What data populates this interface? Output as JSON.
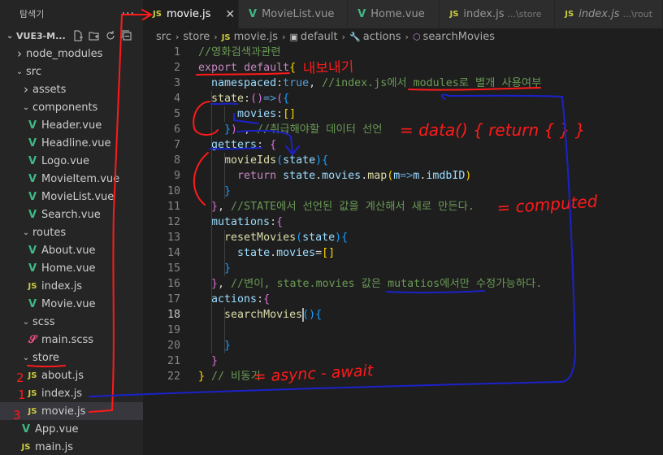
{
  "explorer": {
    "title": "탐색기",
    "more": "···",
    "project": "VUE3-M...",
    "tree": [
      {
        "label": "node_modules",
        "type": "folder",
        "open": false,
        "depth": 1
      },
      {
        "label": "src",
        "type": "folder",
        "open": true,
        "depth": 1
      },
      {
        "label": "assets",
        "type": "folder",
        "open": false,
        "depth": 2
      },
      {
        "label": "components",
        "type": "folder",
        "open": true,
        "depth": 2
      },
      {
        "label": "Header.vue",
        "type": "vue",
        "depth": 3
      },
      {
        "label": "Headline.vue",
        "type": "vue",
        "depth": 3
      },
      {
        "label": "Logo.vue",
        "type": "vue",
        "depth": 3
      },
      {
        "label": "MovieItem.vue",
        "type": "vue",
        "depth": 3
      },
      {
        "label": "MovieList.vue",
        "type": "vue",
        "depth": 3
      },
      {
        "label": "Search.vue",
        "type": "vue",
        "depth": 3
      },
      {
        "label": "routes",
        "type": "folder",
        "open": true,
        "depth": 2
      },
      {
        "label": "About.vue",
        "type": "vue",
        "depth": 3
      },
      {
        "label": "Home.vue",
        "type": "vue",
        "depth": 3
      },
      {
        "label": "index.js",
        "type": "js",
        "depth": 3
      },
      {
        "label": "Movie.vue",
        "type": "vue",
        "depth": 3
      },
      {
        "label": "scss",
        "type": "folder",
        "open": true,
        "depth": 2
      },
      {
        "label": "main.scss",
        "type": "scss",
        "depth": 3
      },
      {
        "label": "store",
        "type": "folder",
        "open": true,
        "depth": 2
      },
      {
        "label": "about.js",
        "type": "js",
        "depth": 3
      },
      {
        "label": "index.js",
        "type": "js",
        "depth": 3
      },
      {
        "label": "movie.js",
        "type": "js",
        "depth": 3,
        "selected": true
      },
      {
        "label": "App.vue",
        "type": "vue",
        "depth": 2
      },
      {
        "label": "main.js",
        "type": "js",
        "depth": 2
      }
    ]
  },
  "tabs": [
    {
      "label": "movie.js",
      "type": "js",
      "active": true,
      "desc": "",
      "close": "✕"
    },
    {
      "label": "MovieList.vue",
      "type": "vue",
      "active": false,
      "desc": ""
    },
    {
      "label": "Home.vue",
      "type": "vue",
      "active": false,
      "desc": ""
    },
    {
      "label": "index.js",
      "type": "js",
      "active": false,
      "desc": "...\\store"
    },
    {
      "label": "index.js",
      "type": "js",
      "active": false,
      "desc": "...\\rout",
      "italic": true
    }
  ],
  "breadcrumb": [
    "src",
    "store",
    "movie.js",
    "default",
    "actions",
    "searchMovies"
  ],
  "editor": {
    "current_line": 18,
    "lines": [
      [
        [
          "t-com",
          "//영화검색과관련"
        ]
      ],
      [
        [
          "t-kw2",
          "export"
        ],
        [
          "t-p",
          " "
        ],
        [
          "t-kw2",
          "default"
        ],
        [
          "t-y",
          "{"
        ]
      ],
      [
        [
          "t-p",
          "  "
        ],
        [
          "t-var",
          "namespaced"
        ],
        [
          "t-p",
          ":"
        ],
        [
          "t-kw",
          "true"
        ],
        [
          "t-p",
          ", "
        ],
        [
          "t-com",
          "//index.js에서 modules로 별개 사용여부"
        ]
      ],
      [
        [
          "t-p",
          "  "
        ],
        [
          "t-fn",
          "state"
        ],
        [
          "t-p",
          ":"
        ],
        [
          "t-pk",
          "()"
        ],
        [
          "t-kw",
          "=>"
        ],
        [
          "t-pk",
          "("
        ],
        [
          "t-bl",
          "{"
        ]
      ],
      [
        [
          "t-p",
          "      "
        ],
        [
          "t-var",
          "movies"
        ],
        [
          "t-p",
          ":"
        ],
        [
          "t-y",
          "[]"
        ]
      ],
      [
        [
          "t-p",
          "    "
        ],
        [
          "t-bl",
          "}"
        ],
        [
          "t-pk",
          ")"
        ],
        [
          "t-p",
          " , "
        ],
        [
          "t-com",
          "//취급해야할 데이터 선언"
        ]
      ],
      [
        [
          "t-p",
          "  "
        ],
        [
          "t-var",
          "getters"
        ],
        [
          "t-p",
          ": "
        ],
        [
          "t-pk",
          "{"
        ]
      ],
      [
        [
          "t-p",
          "    "
        ],
        [
          "t-fn",
          "movieIds"
        ],
        [
          "t-bl",
          "("
        ],
        [
          "t-var",
          "state"
        ],
        [
          "t-bl",
          ")"
        ],
        [
          "t-bl",
          "{"
        ]
      ],
      [
        [
          "t-p",
          "      "
        ],
        [
          "t-kw2",
          "return"
        ],
        [
          "t-p",
          " "
        ],
        [
          "t-var",
          "state"
        ],
        [
          "t-p",
          "."
        ],
        [
          "t-var",
          "movies"
        ],
        [
          "t-p",
          "."
        ],
        [
          "t-fn",
          "map"
        ],
        [
          "t-y",
          "("
        ],
        [
          "t-var",
          "m"
        ],
        [
          "t-kw",
          "=>"
        ],
        [
          "t-var",
          "m"
        ],
        [
          "t-p",
          "."
        ],
        [
          "t-var",
          "imdbID"
        ],
        [
          "t-y",
          ")"
        ]
      ],
      [
        [
          "t-p",
          "    "
        ],
        [
          "t-bl",
          "}"
        ]
      ],
      [
        [
          "t-p",
          "  "
        ],
        [
          "t-pk",
          "}"
        ],
        [
          "t-p",
          ", "
        ],
        [
          "t-com",
          "//STATE에서 선언된 값을 계산해서 새로 만든다."
        ]
      ],
      [
        [
          "t-p",
          "  "
        ],
        [
          "t-var",
          "mutations"
        ],
        [
          "t-p",
          ":"
        ],
        [
          "t-pk",
          "{"
        ]
      ],
      [
        [
          "t-p",
          "    "
        ],
        [
          "t-fn",
          "resetMovies"
        ],
        [
          "t-bl",
          "("
        ],
        [
          "t-var",
          "state"
        ],
        [
          "t-bl",
          ")"
        ],
        [
          "t-bl",
          "{"
        ]
      ],
      [
        [
          "t-p",
          "      "
        ],
        [
          "t-var",
          "state"
        ],
        [
          "t-p",
          "."
        ],
        [
          "t-var",
          "movies"
        ],
        [
          "t-p",
          "="
        ],
        [
          "t-y",
          "[]"
        ]
      ],
      [
        [
          "t-p",
          "    "
        ],
        [
          "t-bl",
          "}"
        ]
      ],
      [
        [
          "t-p",
          "  "
        ],
        [
          "t-pk",
          "}"
        ],
        [
          "t-p",
          ", "
        ],
        [
          "t-com",
          "//변이, state.movies 값은 mutatios에서만 수정가능하다."
        ]
      ],
      [
        [
          "t-p",
          "  "
        ],
        [
          "t-var",
          "actions"
        ],
        [
          "t-p",
          ":"
        ],
        [
          "t-pk",
          "{"
        ]
      ],
      [
        [
          "t-p",
          "    "
        ],
        [
          "t-fn",
          "searchMovies"
        ],
        [
          "t-bl",
          "()"
        ],
        [
          "t-bl",
          "{"
        ]
      ],
      [
        [
          "t-p",
          ""
        ]
      ],
      [
        [
          "t-p",
          "    "
        ],
        [
          "t-bl",
          "}"
        ]
      ],
      [
        [
          "t-p",
          "  "
        ],
        [
          "t-pk",
          "}"
        ]
      ],
      [
        [
          "t-y",
          "}"
        ],
        [
          "t-p",
          " "
        ],
        [
          "t-com",
          "// 비동기"
        ]
      ]
    ]
  },
  "annotations": {
    "export_note": "내보내기",
    "state_note": "= data() { return { } }",
    "getters_note": "= computed",
    "async_note": "= async - await",
    "numbers": [
      "1",
      "2",
      "3"
    ]
  },
  "colors": {
    "annotation_red": "#ff1a1a",
    "annotation_blue": "#1b22c9",
    "accent_js": "#cbcb41",
    "accent_vue": "#41b883"
  }
}
